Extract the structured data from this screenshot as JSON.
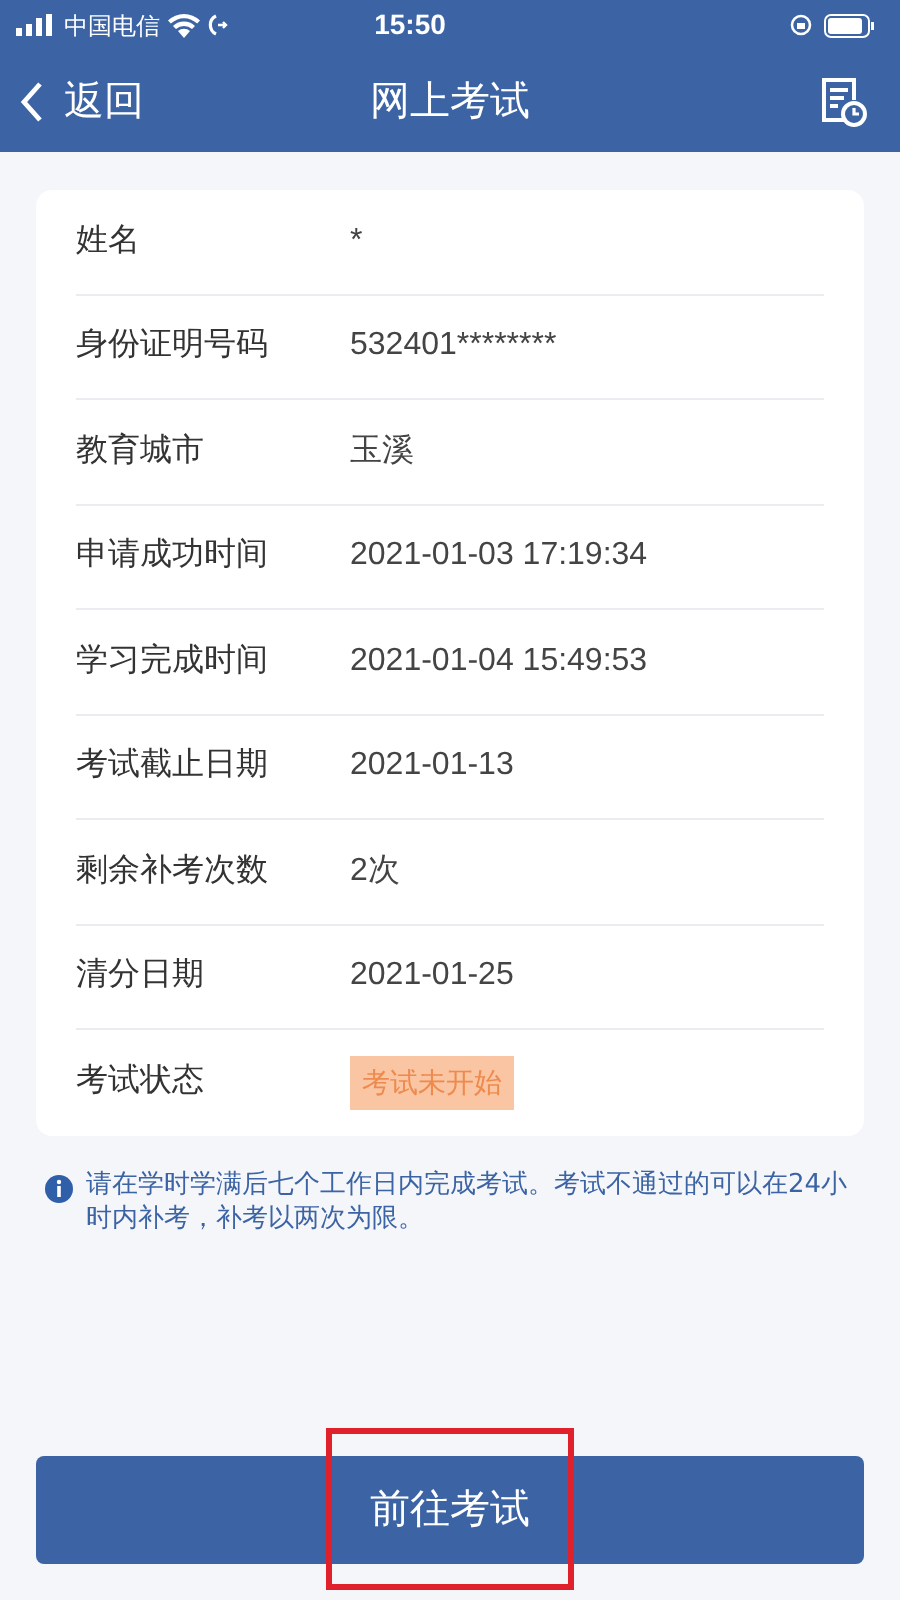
{
  "status_bar": {
    "carrier": "中国电信",
    "time": "15:50"
  },
  "nav": {
    "back": "返回",
    "title": "网上考试"
  },
  "rows": [
    {
      "label": "姓名",
      "value": "*",
      "kind": "text"
    },
    {
      "label": "身份证明号码",
      "value": "532401********",
      "kind": "text"
    },
    {
      "label": "教育城市",
      "value": "玉溪",
      "kind": "text"
    },
    {
      "label": "申请成功时间",
      "value": "2021-01-03 17:19:34",
      "kind": "text"
    },
    {
      "label": "学习完成时间",
      "value": "2021-01-04 15:49:53",
      "kind": "text"
    },
    {
      "label": "考试截止日期",
      "value": "2021-01-13",
      "kind": "text"
    },
    {
      "label": "剩余补考次数",
      "value": "2次",
      "kind": "text"
    },
    {
      "label": "清分日期",
      "value": "2021-01-25",
      "kind": "text"
    },
    {
      "label": "考试状态",
      "value": "考试未开始",
      "kind": "tag"
    }
  ],
  "note": "请在学时学满后七个工作日内完成考试。考试不通过的可以在24小时内补考，补考以两次为限。",
  "button": "前往考试"
}
